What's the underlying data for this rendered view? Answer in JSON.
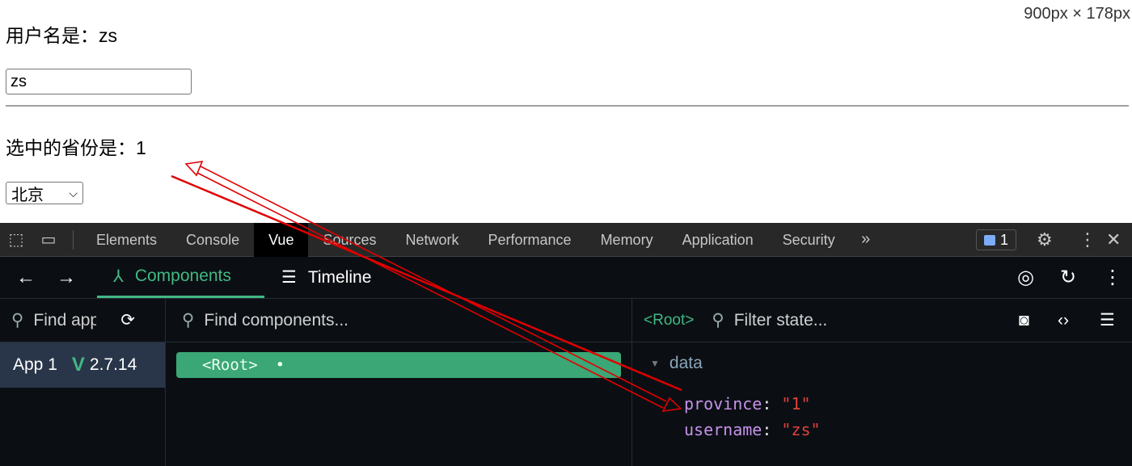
{
  "page": {
    "dimensions": "900px × 178px",
    "username_line": "用户名是：zs",
    "username_value": "zs",
    "province_line": "选中的省份是：1",
    "select_value": "北京"
  },
  "devtools": {
    "tabs": [
      "Elements",
      "Console",
      "Vue",
      "Sources",
      "Network",
      "Performance",
      "Memory",
      "Application",
      "Security"
    ],
    "active_tab": "Vue",
    "issues_count": "1",
    "vue": {
      "subtabs": [
        "Components",
        "Timeline"
      ],
      "active_subtab": "Components",
      "find_apps_placeholder": "Find apps",
      "find_components_placeholder": "Find components...",
      "filter_state_placeholder": "Filter state...",
      "selected_component": "<Root>",
      "app": {
        "name": "App 1",
        "version": "2.7.14"
      },
      "tree": [
        {
          "label": "<Root>",
          "dot": "•"
        }
      ],
      "state": {
        "section": "data",
        "items": [
          {
            "key": "province",
            "value": "\"1\""
          },
          {
            "key": "username",
            "value": "\"zs\""
          }
        ]
      }
    }
  },
  "colors": {
    "vue_green": "#42b883",
    "annotation": "#e00000",
    "key": "#c792ea",
    "string": "#e0413c"
  }
}
